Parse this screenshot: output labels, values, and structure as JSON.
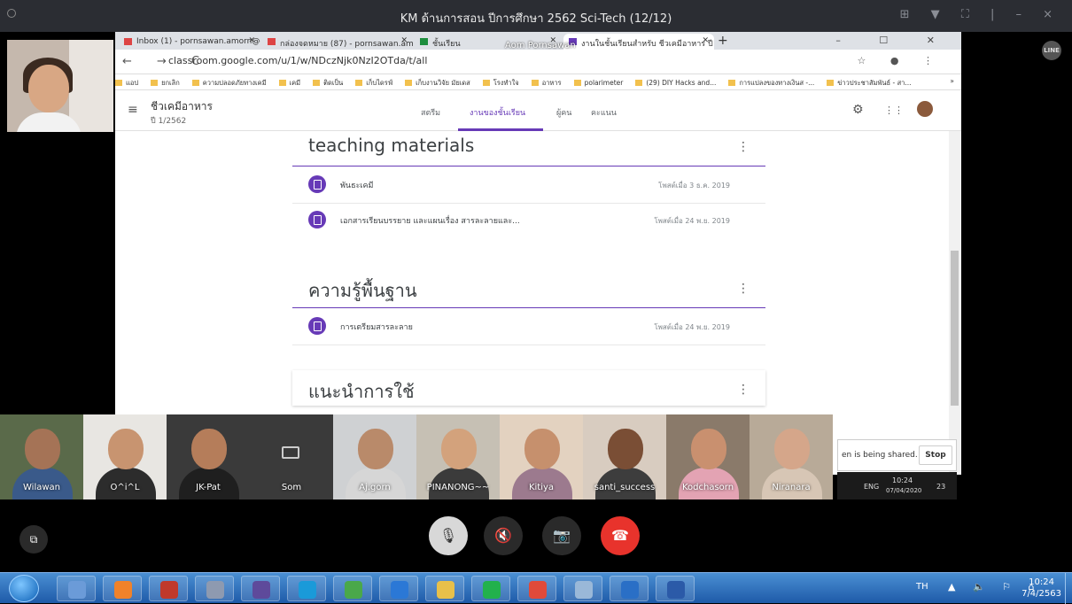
{
  "line_window": {
    "title": "KM ด้านการสอน ปีการศึกษา 2562 Sci-Tech (12/12)",
    "controls": "⊞ ▼ ⛶ | – ×",
    "logo": "LINE"
  },
  "browser": {
    "tabs": [
      {
        "title": "Inbox (1) - pornsawan.amorn@g"
      },
      {
        "title": "กล่องจดหมาย (87) - pornsawan.am"
      },
      {
        "title": "ชั้นเรียน"
      },
      {
        "title": "งานในชั้นเรียนสำหรับ ชีวเคมีอาหาร ปี"
      }
    ],
    "presenter_label": "Aom Pornsawan",
    "window_controls": "– ☐ ✕",
    "nav": "← → C",
    "url": "classroom.google.com/u/1/w/NDczNjk0NzI2OTda/t/all",
    "addr_icons": "☆ ● ⋮",
    "bookmarks": [
      "แอป",
      "ยกเลิก",
      "ความปลอดภัยทางเคมี",
      "เคมี",
      "ติดเป็น",
      "เก็บไดรฟ์",
      "เก็บงานวิจัย มัยเดส",
      "โรงทำใจ",
      "อาหาร",
      "polarimeter",
      "(29) DIY Hacks and...",
      "การแปลงของทางเงินส -...",
      "ข่าวประชาสัมพันธ์ - สา..."
    ],
    "bookmarks_more": "»"
  },
  "classroom": {
    "menu_icon": "≡",
    "class_name": "ชีวเคมีอาหาร",
    "class_sub": "ปี 1/2562",
    "nav_tabs": [
      {
        "label": "สตรีม",
        "active": false
      },
      {
        "label": "งานของชั้นเรียน",
        "active": true
      },
      {
        "label": "ผู้คน",
        "active": false
      },
      {
        "label": "คะแนน",
        "active": false
      }
    ],
    "topbar_icons": [
      "gear-icon",
      "apps-grid-icon",
      "account-avatar"
    ],
    "gear_glyph": "⚙",
    "apps_glyph": "⋮⋮",
    "sections": [
      {
        "title": "teaching materials",
        "items": [
          {
            "name": "พันธะเคมี",
            "date": "โพสต์เมื่อ 3 ธ.ค. 2019"
          },
          {
            "name": "เอกสารเรียนบรรยาย และแผนเรื่อง สารละลายและ...",
            "date": "โพสต์เมื่อ 24 พ.ย. 2019"
          }
        ]
      },
      {
        "title": "ความรู้พื้นฐาน",
        "items": [
          {
            "name": "การเตรียมสารละลาย",
            "date": "โพสต์เมื่อ 24 พ.ย. 2019"
          }
        ]
      },
      {
        "title": "แนะนำการใช้",
        "items": []
      }
    ],
    "more_glyph": "⋮"
  },
  "share_banner": {
    "text": "en is being shared.",
    "stop": "Stop"
  },
  "mini_tray": {
    "lang": "ENG",
    "time": "10:24",
    "date": "07/04/2020",
    "count": "23"
  },
  "participants": [
    {
      "name": "Wilawan",
      "bg": "#5a6a4a",
      "skin": "#a57356",
      "shirt": "#3a5a8a"
    },
    {
      "name": "O^i^L",
      "bg": "#e8e6e2",
      "skin": "#c89470",
      "shirt": "#2c2c2c"
    },
    {
      "name": "JK-Pat",
      "bg": "#3a3a3a",
      "skin": "#b57d5a",
      "shirt": "#1f1f1f"
    },
    {
      "name": "Som",
      "bg": "#3a3a3a",
      "skin": "",
      "shirt": "",
      "camera_off": true
    },
    {
      "name": "Aj.gorn",
      "bg": "#cfd1d3",
      "skin": "#b98a6a",
      "shirt": "#d6d6d6"
    },
    {
      "name": "PINANONG~~",
      "bg": "#c6c0b4",
      "skin": "#d3a27c",
      "shirt": "#3b3b3b"
    },
    {
      "name": "Kitiya",
      "bg": "#e3d2c0",
      "skin": "#c6906d",
      "shirt": "#9c7a8e"
    },
    {
      "name": "santi_success",
      "bg": "#d8ccc0",
      "skin": "#7a4e35",
      "shirt": "#3d3d3d"
    },
    {
      "name": "Kodchasorn",
      "bg": "#8a7a6a",
      "skin": "#c9906f",
      "shirt": "#e3a3b3"
    },
    {
      "name": "Niranara",
      "bg": "#b8aa98",
      "skin": "#d5a68a",
      "shirt": "#d7c6b5"
    }
  ],
  "controls": {
    "mic": "🎙",
    "speaker": "🔇",
    "video": "📷",
    "end": "☎",
    "screen": "⧉"
  },
  "taskbar": {
    "apps": [
      {
        "name": "calculator-app",
        "color": "#6b9bd8"
      },
      {
        "name": "media-player-app",
        "color": "#f0822a"
      },
      {
        "name": "spreadsheet-app",
        "color": "#c0392b"
      },
      {
        "name": "math-app",
        "color": "#8e9ab0"
      },
      {
        "name": "visual-studio-app",
        "color": "#5e4a9b"
      },
      {
        "name": "skype-app",
        "color": "#1a9ad9"
      },
      {
        "name": "paint-app",
        "color": "#4aa84a"
      },
      {
        "name": "ie-app",
        "color": "#2b78d6"
      },
      {
        "name": "explorer-app",
        "color": "#e8c04a"
      },
      {
        "name": "line-app",
        "color": "#22b14c"
      },
      {
        "name": "chrome-app",
        "color": "#e04a3a"
      },
      {
        "name": "tool-app",
        "color": "#9ab8d8"
      },
      {
        "name": "help-app",
        "color": "#2a6fc6"
      },
      {
        "name": "word-app",
        "color": "#2b5aa8"
      }
    ],
    "lang": "TH",
    "tray_icons": "▲ 🔈 ⚐ ⌂",
    "time": "10:24",
    "date": "7/4/2563"
  }
}
